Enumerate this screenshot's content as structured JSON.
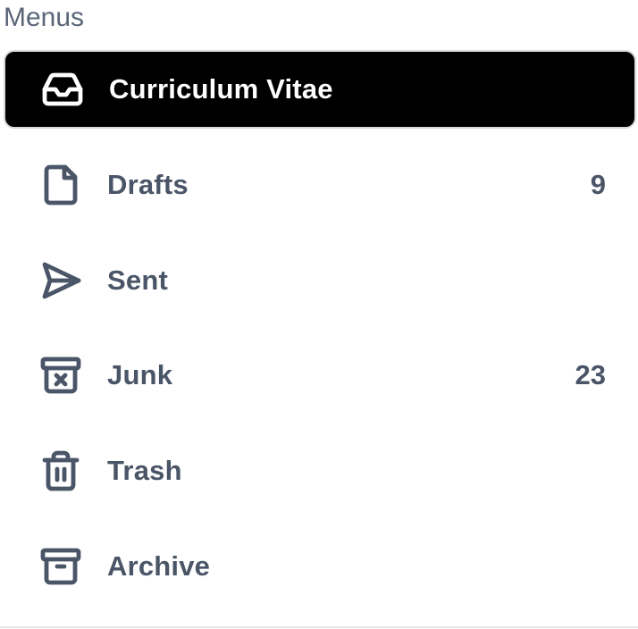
{
  "section": {
    "label": "Menus"
  },
  "colors": {
    "active_bg": "#000000",
    "active_text": "#ffffff",
    "item_text": "#4a5567",
    "section_label": "#5a6678"
  },
  "menu": {
    "items": [
      {
        "label": "Curriculum Vitae",
        "icon": "inbox-icon",
        "count": "",
        "active": true
      },
      {
        "label": "Drafts",
        "icon": "file-icon",
        "count": "9",
        "active": false
      },
      {
        "label": "Sent",
        "icon": "send-icon",
        "count": "",
        "active": false
      },
      {
        "label": "Junk",
        "icon": "archive-x-icon",
        "count": "23",
        "active": false
      },
      {
        "label": "Trash",
        "icon": "trash-icon",
        "count": "",
        "active": false
      },
      {
        "label": "Archive",
        "icon": "archive-icon",
        "count": "",
        "active": false
      }
    ]
  }
}
